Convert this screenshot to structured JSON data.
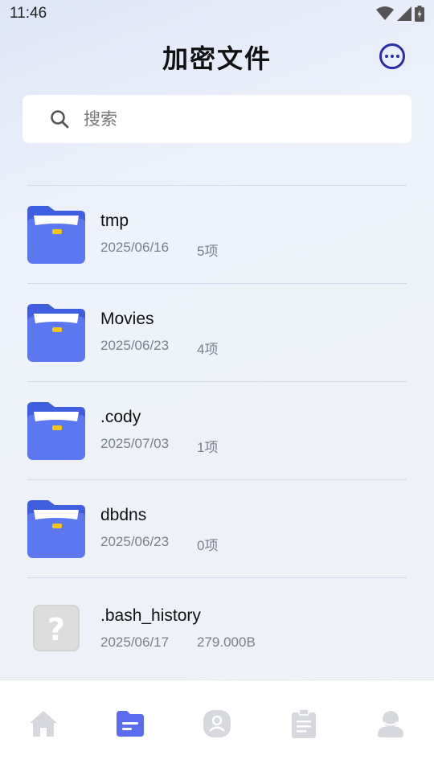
{
  "status_bar": {
    "time": "11:46",
    "icons": [
      "wifi-icon",
      "signal-icon",
      "battery-icon"
    ]
  },
  "header": {
    "title": "加密文件",
    "more_icon": "more-options-icon",
    "accent_color": "#2a2fa8"
  },
  "search": {
    "placeholder": "搜索",
    "value": "",
    "icon": "search-icon"
  },
  "files": [
    {
      "name": "tmp",
      "date": "2025/06/16",
      "info": "5项",
      "type": "folder"
    },
    {
      "name": "Movies",
      "date": "2025/06/23",
      "info": "4项",
      "type": "folder"
    },
    {
      "name": ".cody",
      "date": "2025/07/03",
      "info": "1项",
      "type": "folder"
    },
    {
      "name": "dbdns",
      "date": "2025/06/23",
      "info": "0项",
      "type": "folder"
    },
    {
      "name": ".bash_history",
      "date": "2025/06/17",
      "info": "279.000B",
      "type": "unknown"
    }
  ],
  "bottom_nav": {
    "active_index": 1,
    "active_color": "#5b6cf0",
    "inactive_color": "#d6d8dd",
    "items": [
      "home-icon",
      "files-icon",
      "contacts-icon",
      "clipboard-icon",
      "profile-icon"
    ]
  },
  "colors": {
    "folder_main": "#5b78f0",
    "folder_tab": "#3f5fe0",
    "folder_clip": "#f5c518"
  }
}
